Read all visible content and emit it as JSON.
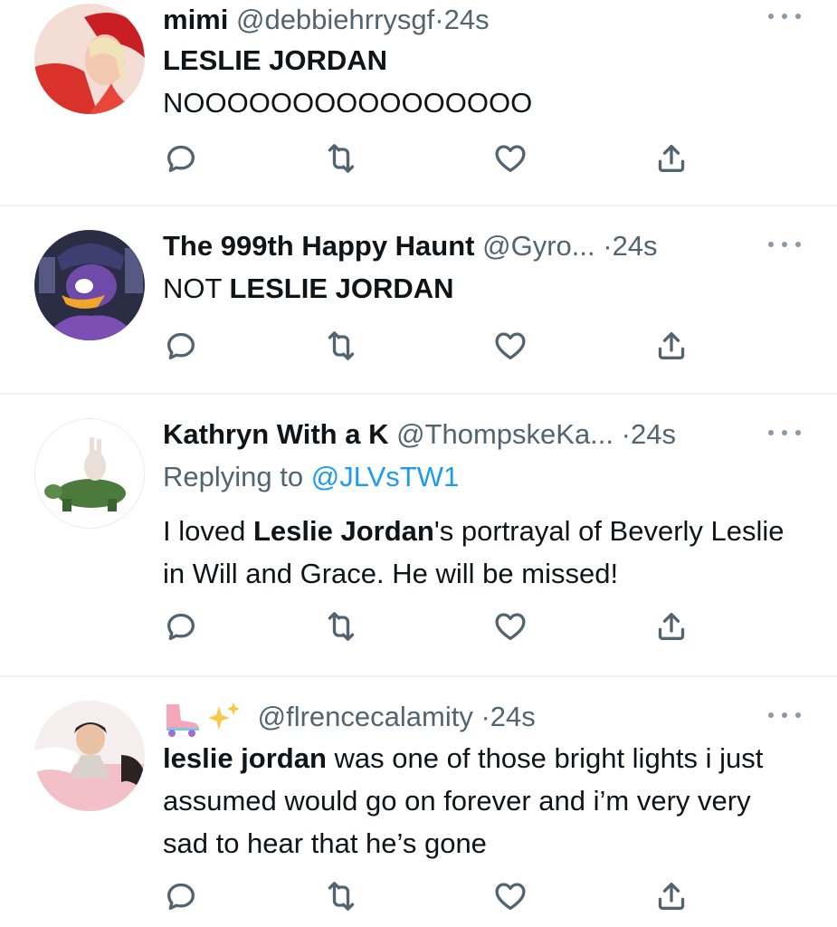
{
  "colors": {
    "text": "#0f1419",
    "secondary": "#536471",
    "link": "#1d9bf0",
    "divider": "#eff3f4",
    "icon": "#536471"
  },
  "icons": {
    "reply": "reply-icon",
    "retweet": "retweet-icon",
    "like": "heart-icon",
    "share": "share-icon",
    "more": "more-icon"
  },
  "tweets": [
    {
      "name": "mimi",
      "handle": "@debbiehrrysgf",
      "dot": "·",
      "time": "24s",
      "lines": [
        {
          "bold": "LESLIE JORDAN"
        },
        {
          "plain": "NOOOOOOOOOOOOOOOO"
        }
      ]
    },
    {
      "name": "The 999th Happy Haunt",
      "handle": "@Gyro...",
      "dot": "·",
      "time": "24s",
      "body_prefix": "NOT ",
      "body_bold": "LESLIE JORDAN"
    },
    {
      "name": "Kathryn With a K",
      "handle": "@ThompskeKa...",
      "dot": "·",
      "time": "24s",
      "replying_label": "Replying to ",
      "replying_to": "@JLVsTW1",
      "body_prefix": "I loved ",
      "body_bold": "Leslie Jordan",
      "body_suffix": "'s portrayal of Beverly Leslie in Will and Grace. He will be missed!"
    },
    {
      "name_emoji": "roller-skate + sparkles",
      "handle": "@flrencecalamity",
      "dot": "·",
      "time": "24s",
      "body_bold": "leslie jordan",
      "body_suffix": " was one of those bright lights i just assumed would go on forever and i’m very very sad to hear that he’s gone"
    }
  ]
}
